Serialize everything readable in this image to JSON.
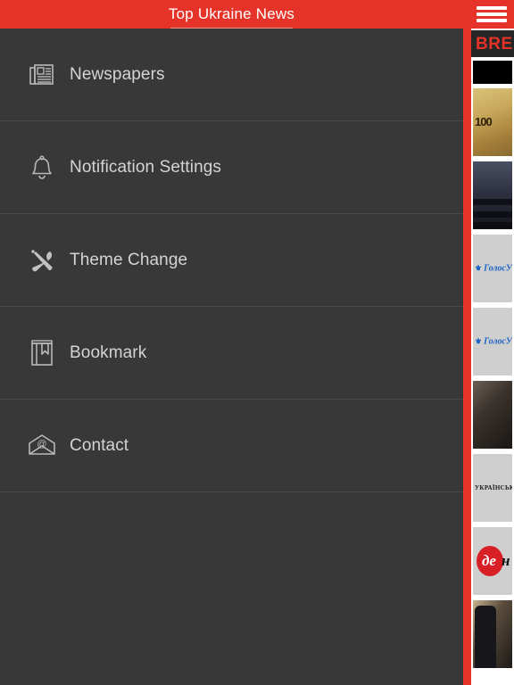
{
  "header": {
    "title": "Top Ukraine News"
  },
  "menu": {
    "items": [
      {
        "label": "Newspapers",
        "icon": "newspaper-icon"
      },
      {
        "label": "Notification Settings",
        "icon": "bell-icon"
      },
      {
        "label": "Theme Change",
        "icon": "paintbrush-pencil-icon"
      },
      {
        "label": "Bookmark",
        "icon": "book-bookmark-icon"
      },
      {
        "label": "Contact",
        "icon": "envelope-at-icon"
      }
    ]
  },
  "content": {
    "menu_icon": "hamburger-icon",
    "breaking_label": "BRE",
    "cards": [
      {
        "kind": "photo-money",
        "caption": "100"
      },
      {
        "kind": "photo-hall",
        "caption": ""
      },
      {
        "kind": "logo-holos",
        "caption": "ГолосУк"
      },
      {
        "kind": "logo-holos",
        "caption": "ГолосУк"
      },
      {
        "kind": "photo-ruin",
        "caption": ""
      },
      {
        "kind": "logo-ukrainska",
        "caption": "УКРАЇНСЬКА"
      },
      {
        "kind": "logo-den",
        "caption": "де"
      },
      {
        "kind": "photo-person",
        "caption": ""
      }
    ]
  },
  "colors": {
    "accent_red": "#e5332a",
    "menu_bg": "#383838",
    "menu_divider": "#4a4a4a",
    "menu_text": "#d4d4d4",
    "breaking_bg": "#262626"
  }
}
